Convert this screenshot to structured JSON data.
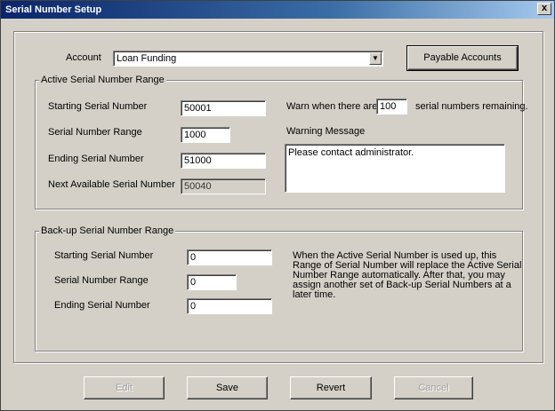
{
  "window": {
    "title": "Serial Number Setup",
    "close_glyph": "x"
  },
  "account": {
    "label": "Account",
    "value": "Loan Funding",
    "payable_button": "Payable Accounts"
  },
  "active": {
    "title": "Active Serial Number Range",
    "starting_label": "Starting Serial Number",
    "starting_value": "50001",
    "range_label": "Serial Number Range",
    "range_value": "1000",
    "ending_label": "Ending Serial Number",
    "ending_value": "51000",
    "next_label": "Next Available Serial Number",
    "next_value": "50040",
    "warn_prefix": "Warn when there are",
    "warn_value": "100",
    "warn_suffix": "serial numbers remaining.",
    "warning_message_label": "Warning Message",
    "warning_message_value": "Please contact administrator."
  },
  "backup": {
    "title": "Back-up Serial Number Range",
    "starting_label": "Starting Serial Number",
    "starting_value": "0",
    "range_label": "Serial Number Range",
    "range_value": "0",
    "ending_label": "Ending Serial Number",
    "ending_value": "0",
    "info": "When the Active Serial Number is used up, this Range of Serial Number will replace the Active Serial Number Range automatically.  After that, you may assign another set of Back-up Serial Numbers at a later time."
  },
  "buttons": {
    "edit": "Edit",
    "save": "Save",
    "revert": "Revert",
    "cancel": "Cancel"
  }
}
